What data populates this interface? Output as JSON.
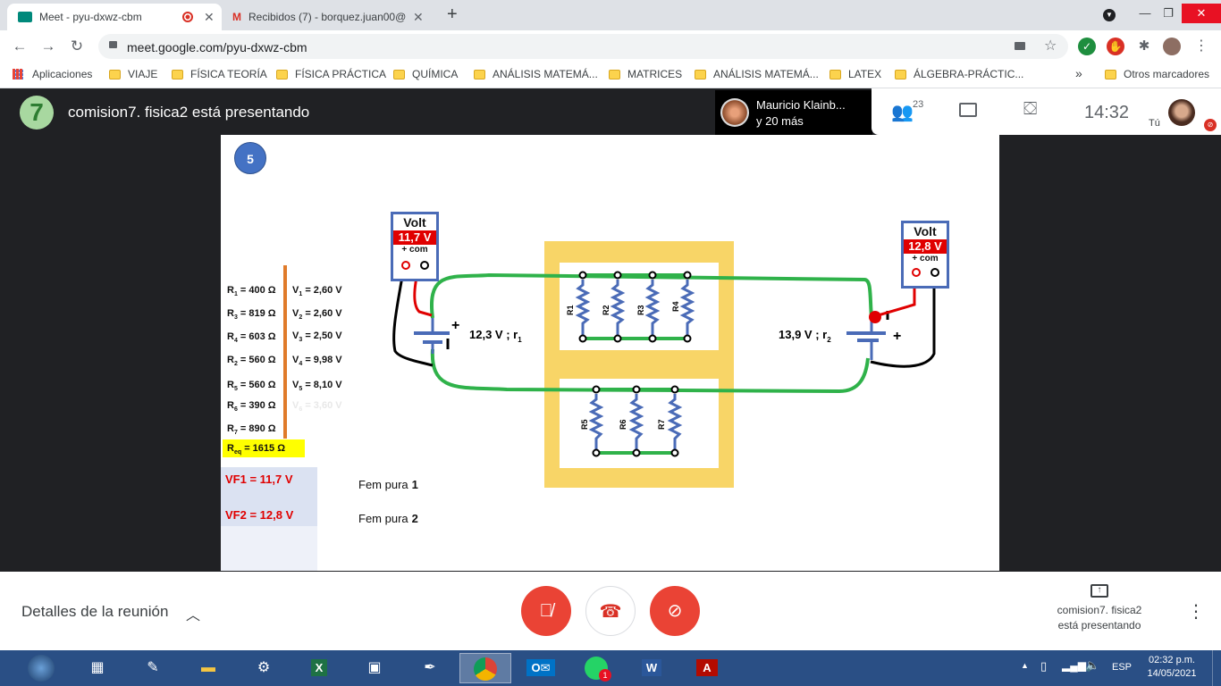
{
  "browser": {
    "tabs": [
      {
        "title": "Meet - pyu-dxwz-cbm",
        "active": true
      },
      {
        "title": "Recibidos (7) - borquez.juan00@",
        "active": false
      }
    ],
    "url": "meet.google.com/pyu-dxwz-cbm",
    "bookmarks": [
      "Aplicaciones",
      "VIAJE",
      "FÍSICA TEORÍA",
      "FÍSICA PRÁCTICA",
      "QUÍMICA",
      "ANÁLISIS MATEMÁ...",
      "MATRICES",
      "ANÁLISIS MATEMÁ...",
      "LATEX",
      "ÁLGEBRA-PRÁCTIC..."
    ],
    "bookmarks_more": "»",
    "other_bookmarks": "Otros marcadores"
  },
  "meet": {
    "logo_text": "7",
    "presenting_title": "comision7. fisica2 está presentando",
    "participant_name": "Mauricio Klainb...",
    "participant_more": "y 20 más",
    "participants_count": "23",
    "time": "14:32",
    "self_label": "Tú",
    "details_label": "Detalles de la reunión",
    "presenting_card": [
      "comision7. fisica2",
      "está presentando"
    ]
  },
  "slide": {
    "badge": "5",
    "resistors": [
      {
        "label": "R",
        "sub": "1",
        "val": "= 400 Ω"
      },
      {
        "label": "R",
        "sub": "3",
        "val": "= 819 Ω"
      },
      {
        "label": "R",
        "sub": "4",
        "val": "= 603 Ω"
      },
      {
        "label": "R",
        "sub": "2",
        "val": "= 560 Ω"
      },
      {
        "label": "R",
        "sub": "5",
        "val": "= 560 Ω"
      },
      {
        "label": "R",
        "sub": "6",
        "val": "= 390 Ω"
      },
      {
        "label": "R",
        "sub": "7",
        "val": "= 890 Ω"
      }
    ],
    "voltages": [
      {
        "label": "V",
        "sub": "1",
        "val": "= 2,60 V"
      },
      {
        "label": "V",
        "sub": "2",
        "val": "= 2,60 V"
      },
      {
        "label": "V",
        "sub": "3",
        "val": "= 2,50 V"
      },
      {
        "label": "V",
        "sub": "4",
        "val": "= 9,98 V"
      },
      {
        "label": "V",
        "sub": "5",
        "val": "= 8,10 V"
      },
      {
        "label": "V",
        "sub": "6",
        "val": "= 3,60 V"
      }
    ],
    "req_label": "R",
    "req_sub": "eq",
    "req_val": "= 1615 Ω",
    "vf1": "VF1  =  11,7 V",
    "vf2": "VF2  =  12,8 V",
    "fem1_text": "Fem pura",
    "fem1_num": "1",
    "fem2_text": "Fem pura",
    "fem2_num": "2",
    "voltmeter_left": {
      "title": "Volt",
      "value": "11,7 V",
      "terminals": "+  com"
    },
    "voltmeter_right": {
      "title": "Volt",
      "value": "12,8 V",
      "terminals": "+  com"
    },
    "source_left": {
      "emf": "12,3 V ;  r",
      "sub": "1",
      "plus": "+"
    },
    "source_right": {
      "emf": "13,9 V  ;  r",
      "sub": "2",
      "plus": "+"
    },
    "top_resistors": [
      "R1",
      "R2",
      "R3",
      "R4"
    ],
    "bottom_resistors": [
      "R5",
      "R6",
      "R7"
    ]
  },
  "taskbar": {
    "lang": "ESP",
    "time": "02:32 p.m.",
    "date": "14/05/2021",
    "whatsapp_badge": "1"
  },
  "colors": {
    "wire_green": "#2fb24a",
    "frame_yellow": "#f8d567",
    "resistor_blue": "#4a6bb7",
    "red": "#e00000",
    "orange_bar": "#e07b2a",
    "req_yellow": "#ffff00",
    "vf_bg": "#dbe2f2"
  }
}
